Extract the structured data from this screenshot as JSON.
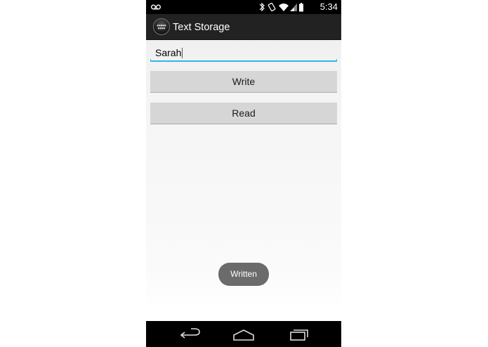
{
  "status_bar": {
    "time": "5:34",
    "icons": [
      "voicemail-icon",
      "bluetooth-icon",
      "vibrate-icon",
      "wifi-icon",
      "signal-icon",
      "battery-icon"
    ]
  },
  "action_bar": {
    "title": "Text Storage",
    "logo_icon": "app-logo-icon"
  },
  "form": {
    "name_value": "Sarah",
    "write_label": "Write",
    "read_label": "Read"
  },
  "toast": {
    "message": "Written"
  },
  "nav_bar": {
    "icons": [
      "back-icon",
      "home-icon",
      "recents-icon"
    ]
  },
  "colors": {
    "accent": "#33b5e5",
    "action_bar": "#222222",
    "button": "#d6d6d6",
    "toast": "#6b6b6b"
  }
}
